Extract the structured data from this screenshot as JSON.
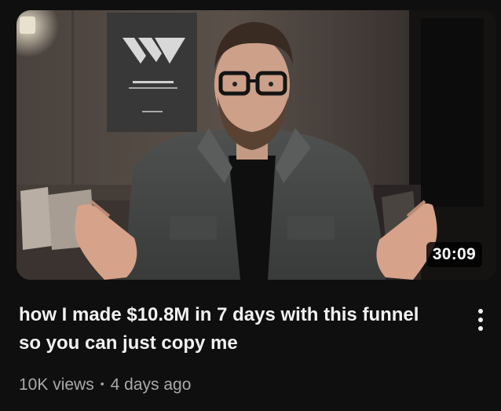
{
  "video": {
    "duration": "30:09",
    "title": "how I made $10.8M in 7 days with this funnel so you can just copy me",
    "views": "10K views",
    "separator": "•",
    "age": "4 days ago"
  },
  "icons": {
    "menu": "more-vert-icon"
  }
}
